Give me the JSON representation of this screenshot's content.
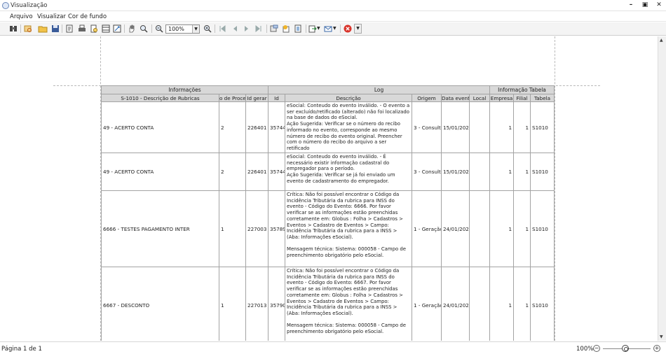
{
  "window": {
    "title": "Visualização"
  },
  "menu": [
    {
      "label": "Arquivo"
    },
    {
      "label": "Visualizar"
    },
    {
      "label": "Cor de fundo"
    }
  ],
  "toolbar": {
    "zoom_value": "100%",
    "icons": [
      "binoculars-icon",
      "search-doc-icon",
      "open-folder-icon",
      "save-icon",
      "page-setup-icon",
      "print-icon",
      "print-preview-icon",
      "header-footer-icon",
      "scale-icon",
      "hand-tool-icon",
      "magnifier-icon",
      "zoom-out-icon",
      "zoom-in-icon",
      "first-page-icon",
      "previous-page-icon",
      "next-page-icon",
      "last-page-icon",
      "background-color-icon",
      "watermark-icon",
      "export-icon",
      "send-email-icon",
      "close-preview-icon"
    ]
  },
  "report": {
    "groups": {
      "informacoes": "Informações",
      "log": "Log",
      "info_tabela": "Informação Tabela"
    },
    "columns": {
      "rubrica": "S-1010 - Descrição de Rubricas",
      "processo": "o de Proce",
      "id_gerar": "Id gerar",
      "id": "Id",
      "descricao": "Descrição",
      "origem": "Origem",
      "data_evento": "Data evento",
      "local": "Local",
      "empresa": "Empresa",
      "filial": "Filial",
      "tabela": "Tabela"
    },
    "rows": [
      {
        "rubrica": "49 - ACERTO CONTA",
        "processo": "2",
        "id_gerar": "226401",
        "id": "35744",
        "descricao": "eSocial: Conteudo do evento inválido. - O evento a ser excluído/retificado (alterado) não foi localizado na base de dados do eSocial.\nAção Sugerida: Verificar se o número do recibo informado no evento, corresponde ao mesmo número de recibo do evento original. Preencher com o número do recibo do arquivo a ser retificado",
        "origem": "3 - Consult",
        "data_evento": "15/01/202",
        "local": "",
        "empresa": "1",
        "filial": "1",
        "tabela": "S1010"
      },
      {
        "rubrica": "49 - ACERTO CONTA",
        "processo": "2",
        "id_gerar": "226401",
        "id": "35744",
        "descricao": "eSocial: Conteudo do evento inválido. - É necessário existir informação cadastral do empregador para o período.\nAção Sugerida: Verificar se já foi enviado um evento de cadastramento do empregador.",
        "origem": "3 - Consult",
        "data_evento": "15/01/202",
        "local": "",
        "empresa": "1",
        "filial": "1",
        "tabela": "S1010"
      },
      {
        "rubrica": "6666 - TESTES PAGAMENTO INTER",
        "processo": "1",
        "id_gerar": "227003",
        "id": "35789",
        "descricao": "Crítica: Não foi possível encontrar o Código da Incidência Tributária da rubrica para INSS do evento - Código do Evento: 6666. Por favor verificar se as informações estão preenchidas corretamente em: Globus : Folha > Cadastros > Eventos > Cadastro de Eventos > Campo: Incidência Tributária da rubrica para a INSS > (Aba: Informações eSocial).\n\nMensagem técnica: Sistema: 000058 - Campo de preenchimento obrigatório pelo eSocial.",
        "origem": "1 - Geração",
        "data_evento": "24/01/202",
        "local": "",
        "empresa": "1",
        "filial": "1",
        "tabela": "S1010"
      },
      {
        "rubrica": "6667 - DESCONTO",
        "processo": "1",
        "id_gerar": "227013",
        "id": "35790",
        "descricao": "Crítica: Não foi possível encontrar o Código da Incidência Tributária da rubrica para INSS do evento - Código do Evento: 6667. Por favor verificar se as informações estão preenchidas corretamente em: Globus : Folha > Cadastros > Eventos > Cadastro de Eventos > Campo: Incidência Tributária da rubrica para a INSS > (Aba: Informações eSocial).\n\nMensagem técnica: Sistema: 000058 - Campo de preenchimento obrigatório pelo eSocial.",
        "origem": "1 - Geração",
        "data_evento": "24/01/202",
        "local": "",
        "empresa": "1",
        "filial": "1",
        "tabela": "S1010"
      }
    ]
  },
  "status": {
    "page_label": "Página 1 de 1",
    "zoom_label": "100%"
  }
}
